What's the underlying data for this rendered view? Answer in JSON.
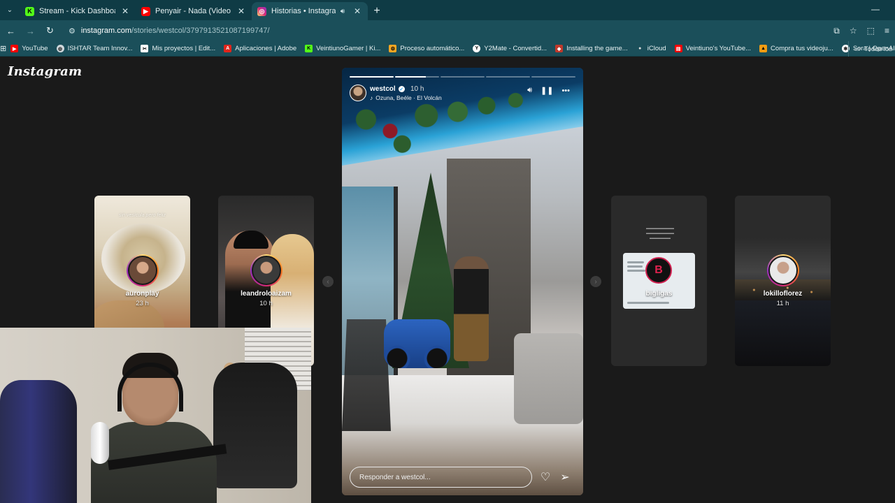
{
  "browser": {
    "tabs": [
      {
        "title": "Stream - Kick Dashboard",
        "favicon": "kick-icon",
        "color": "#53fc18",
        "active": false
      },
      {
        "title": "Penyair - Nada (Video Oficial) -",
        "favicon": "youtube-icon",
        "color": "#ff0000",
        "active": false
      },
      {
        "title": "Historias • Instagram",
        "favicon": "instagram-icon",
        "color": "#e1306c",
        "active": true,
        "audio": true
      }
    ],
    "url_host": "instagram.com",
    "url_path": "/stories/westcol/3797913521087199747/",
    "bookmarks": [
      {
        "label": "YouTube",
        "color": "#ff0000"
      },
      {
        "label": "ISHTAR Team Innov...",
        "color": "#cfd8dc"
      },
      {
        "label": "Mis proyectos | Edit...",
        "color": "#ffffff"
      },
      {
        "label": "Aplicaciones | Adobe",
        "color": "#e1251b"
      },
      {
        "label": "VeintiunoGamer | Ki...",
        "color": "#53fc18"
      },
      {
        "label": "Proceso automático...",
        "color": "#f5a623"
      },
      {
        "label": "Y2Mate - Convertid...",
        "color": "#ffffff"
      },
      {
        "label": "Installing the game...",
        "color": "#c0392b"
      },
      {
        "label": "iCloud",
        "color": "#dddddd"
      },
      {
        "label": "Veintiuno's YouTube...",
        "color": "#ff0000"
      },
      {
        "label": "Compra tus videoju...",
        "color": "#f39c12"
      },
      {
        "label": "Sora | OpenAI",
        "color": "#ffffff"
      }
    ],
    "all_bookmarks": "Todos los"
  },
  "instagram": {
    "logo": "Instagram",
    "side_stories": [
      {
        "name": "auronplay",
        "time": "23 h",
        "caption": "sin vesícula pero feliz"
      },
      {
        "name": "leandroloaizam",
        "time": "10 h"
      },
      {
        "name": "bigligas",
        "time": ""
      },
      {
        "name": "lokilloflorez",
        "time": "11 h"
      }
    ],
    "story": {
      "username": "westcol",
      "time": "10 h",
      "song": "Ozuna, Beéle · El Volcán",
      "progress_segments": [
        1.0,
        0.7,
        0,
        0,
        0
      ],
      "reply_placeholder": "Responder a westcol..."
    }
  }
}
